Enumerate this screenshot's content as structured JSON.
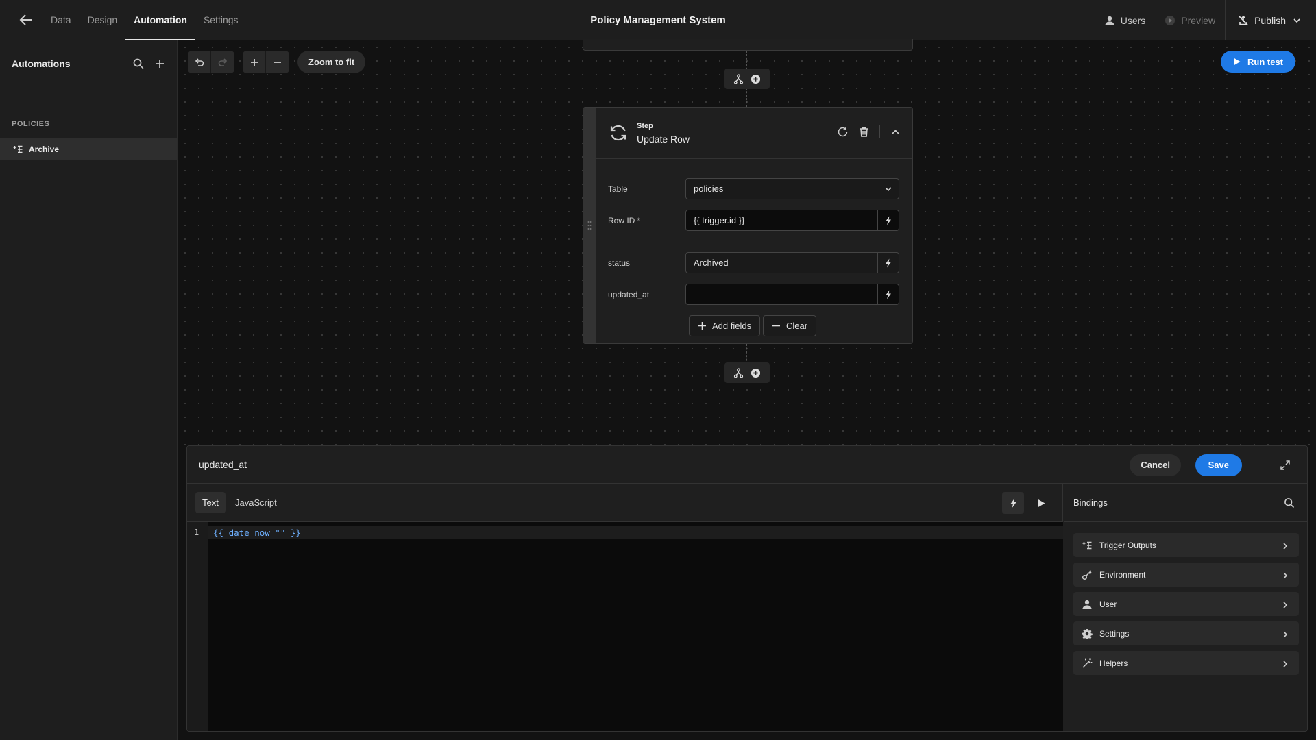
{
  "app": {
    "title": "Policy Management System",
    "nav": [
      "Data",
      "Design",
      "Automation",
      "Settings"
    ],
    "active_nav": "Automation",
    "actions": {
      "users": "Users",
      "preview": "Preview",
      "publish": "Publish"
    }
  },
  "sidebar": {
    "title": "Automations",
    "section": "POLICIES",
    "items": [
      {
        "label": "Archive",
        "active": true
      }
    ]
  },
  "canvas": {
    "zoom_to_fit": "Zoom to fit",
    "run_test": "Run test",
    "step": {
      "kicker": "Step",
      "name": "Update Row",
      "fields": {
        "table_label": "Table",
        "table_value": "policies",
        "rowid_label": "Row ID *",
        "rowid_value": "{{ trigger.id }}",
        "status_label": "status",
        "status_value": "Archived",
        "updated_label": "updated_at",
        "updated_value": ""
      },
      "add_fields": "Add fields",
      "clear": "Clear"
    }
  },
  "panel": {
    "title": "updated_at",
    "cancel": "Cancel",
    "save": "Save",
    "tabs": [
      "Text",
      "JavaScript"
    ],
    "active_tab": "Text",
    "code": {
      "line_number": "1",
      "line": "{{ date now \"\" }}"
    },
    "bindings": {
      "title": "Bindings",
      "items": [
        {
          "label": "Trigger Outputs",
          "icon": "tree-icon"
        },
        {
          "label": "Environment",
          "icon": "key-icon"
        },
        {
          "label": "User",
          "icon": "user-icon"
        },
        {
          "label": "Settings",
          "icon": "gear-icon"
        },
        {
          "label": "Helpers",
          "icon": "magic-wand-icon"
        }
      ]
    }
  },
  "colors": {
    "accent": "#1f7ae6",
    "background": "#121212",
    "surface": "#1f1f1f"
  }
}
